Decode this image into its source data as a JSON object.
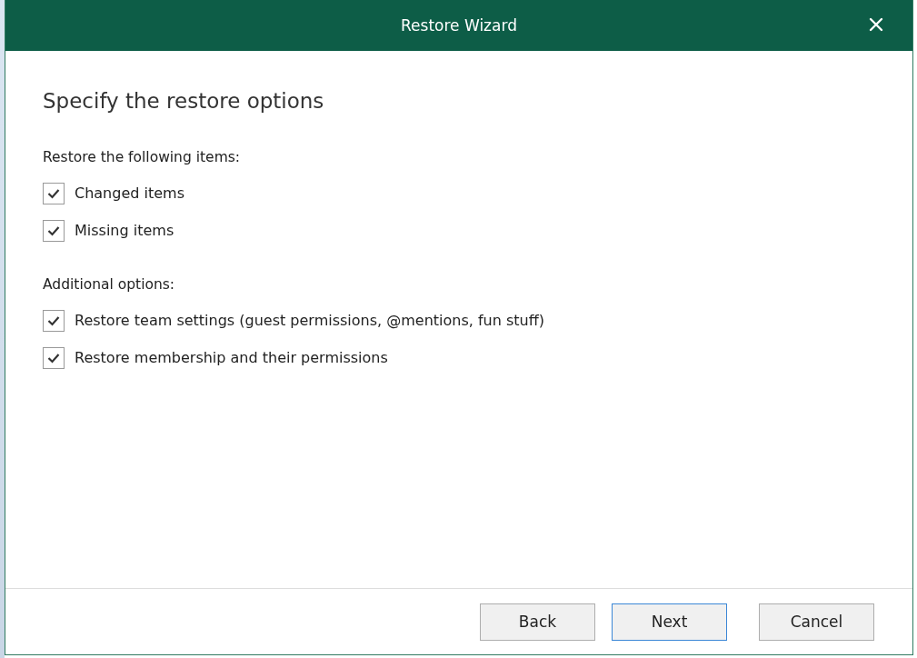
{
  "window": {
    "title": "Restore Wizard"
  },
  "heading": "Specify the restore options",
  "groups": [
    {
      "label": "Restore the following items:",
      "options": [
        {
          "label": "Changed items",
          "checked": true
        },
        {
          "label": "Missing items",
          "checked": true
        }
      ]
    },
    {
      "label": "Additional options:",
      "options": [
        {
          "label": "Restore team settings (guest permissions, @mentions, fun stuff)",
          "checked": true
        },
        {
          "label": "Restore membership and their permissions",
          "checked": true
        }
      ]
    }
  ],
  "buttons": [
    {
      "label": "Back",
      "default": false
    },
    {
      "label": "Next",
      "default": true
    },
    {
      "label": "Cancel",
      "default": false
    }
  ]
}
